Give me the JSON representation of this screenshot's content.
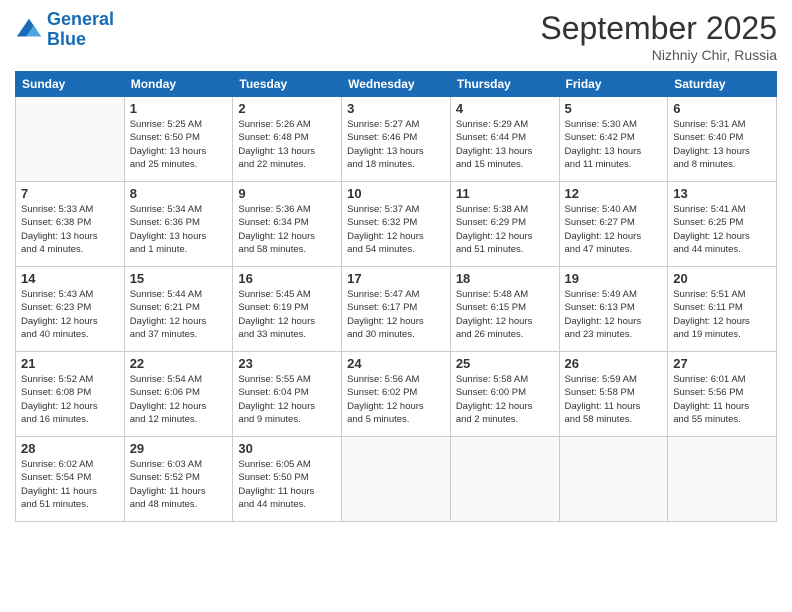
{
  "header": {
    "logo": {
      "line1": "General",
      "line2": "Blue"
    },
    "title": "September 2025",
    "subtitle": "Nizhniy Chir, Russia"
  },
  "weekdays": [
    "Sunday",
    "Monday",
    "Tuesday",
    "Wednesday",
    "Thursday",
    "Friday",
    "Saturday"
  ],
  "weeks": [
    [
      {
        "day": "",
        "info": ""
      },
      {
        "day": "1",
        "info": "Sunrise: 5:25 AM\nSunset: 6:50 PM\nDaylight: 13 hours\nand 25 minutes."
      },
      {
        "day": "2",
        "info": "Sunrise: 5:26 AM\nSunset: 6:48 PM\nDaylight: 13 hours\nand 22 minutes."
      },
      {
        "day": "3",
        "info": "Sunrise: 5:27 AM\nSunset: 6:46 PM\nDaylight: 13 hours\nand 18 minutes."
      },
      {
        "day": "4",
        "info": "Sunrise: 5:29 AM\nSunset: 6:44 PM\nDaylight: 13 hours\nand 15 minutes."
      },
      {
        "day": "5",
        "info": "Sunrise: 5:30 AM\nSunset: 6:42 PM\nDaylight: 13 hours\nand 11 minutes."
      },
      {
        "day": "6",
        "info": "Sunrise: 5:31 AM\nSunset: 6:40 PM\nDaylight: 13 hours\nand 8 minutes."
      }
    ],
    [
      {
        "day": "7",
        "info": "Sunrise: 5:33 AM\nSunset: 6:38 PM\nDaylight: 13 hours\nand 4 minutes."
      },
      {
        "day": "8",
        "info": "Sunrise: 5:34 AM\nSunset: 6:36 PM\nDaylight: 13 hours\nand 1 minute."
      },
      {
        "day": "9",
        "info": "Sunrise: 5:36 AM\nSunset: 6:34 PM\nDaylight: 12 hours\nand 58 minutes."
      },
      {
        "day": "10",
        "info": "Sunrise: 5:37 AM\nSunset: 6:32 PM\nDaylight: 12 hours\nand 54 minutes."
      },
      {
        "day": "11",
        "info": "Sunrise: 5:38 AM\nSunset: 6:29 PM\nDaylight: 12 hours\nand 51 minutes."
      },
      {
        "day": "12",
        "info": "Sunrise: 5:40 AM\nSunset: 6:27 PM\nDaylight: 12 hours\nand 47 minutes."
      },
      {
        "day": "13",
        "info": "Sunrise: 5:41 AM\nSunset: 6:25 PM\nDaylight: 12 hours\nand 44 minutes."
      }
    ],
    [
      {
        "day": "14",
        "info": "Sunrise: 5:43 AM\nSunset: 6:23 PM\nDaylight: 12 hours\nand 40 minutes."
      },
      {
        "day": "15",
        "info": "Sunrise: 5:44 AM\nSunset: 6:21 PM\nDaylight: 12 hours\nand 37 minutes."
      },
      {
        "day": "16",
        "info": "Sunrise: 5:45 AM\nSunset: 6:19 PM\nDaylight: 12 hours\nand 33 minutes."
      },
      {
        "day": "17",
        "info": "Sunrise: 5:47 AM\nSunset: 6:17 PM\nDaylight: 12 hours\nand 30 minutes."
      },
      {
        "day": "18",
        "info": "Sunrise: 5:48 AM\nSunset: 6:15 PM\nDaylight: 12 hours\nand 26 minutes."
      },
      {
        "day": "19",
        "info": "Sunrise: 5:49 AM\nSunset: 6:13 PM\nDaylight: 12 hours\nand 23 minutes."
      },
      {
        "day": "20",
        "info": "Sunrise: 5:51 AM\nSunset: 6:11 PM\nDaylight: 12 hours\nand 19 minutes."
      }
    ],
    [
      {
        "day": "21",
        "info": "Sunrise: 5:52 AM\nSunset: 6:08 PM\nDaylight: 12 hours\nand 16 minutes."
      },
      {
        "day": "22",
        "info": "Sunrise: 5:54 AM\nSunset: 6:06 PM\nDaylight: 12 hours\nand 12 minutes."
      },
      {
        "day": "23",
        "info": "Sunrise: 5:55 AM\nSunset: 6:04 PM\nDaylight: 12 hours\nand 9 minutes."
      },
      {
        "day": "24",
        "info": "Sunrise: 5:56 AM\nSunset: 6:02 PM\nDaylight: 12 hours\nand 5 minutes."
      },
      {
        "day": "25",
        "info": "Sunrise: 5:58 AM\nSunset: 6:00 PM\nDaylight: 12 hours\nand 2 minutes."
      },
      {
        "day": "26",
        "info": "Sunrise: 5:59 AM\nSunset: 5:58 PM\nDaylight: 11 hours\nand 58 minutes."
      },
      {
        "day": "27",
        "info": "Sunrise: 6:01 AM\nSunset: 5:56 PM\nDaylight: 11 hours\nand 55 minutes."
      }
    ],
    [
      {
        "day": "28",
        "info": "Sunrise: 6:02 AM\nSunset: 5:54 PM\nDaylight: 11 hours\nand 51 minutes."
      },
      {
        "day": "29",
        "info": "Sunrise: 6:03 AM\nSunset: 5:52 PM\nDaylight: 11 hours\nand 48 minutes."
      },
      {
        "day": "30",
        "info": "Sunrise: 6:05 AM\nSunset: 5:50 PM\nDaylight: 11 hours\nand 44 minutes."
      },
      {
        "day": "",
        "info": ""
      },
      {
        "day": "",
        "info": ""
      },
      {
        "day": "",
        "info": ""
      },
      {
        "day": "",
        "info": ""
      }
    ]
  ]
}
